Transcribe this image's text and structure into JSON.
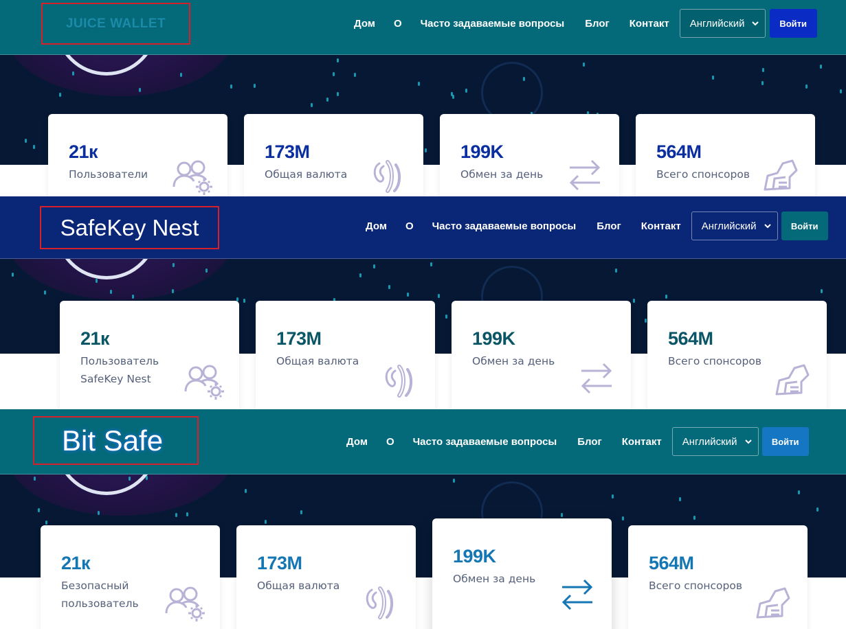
{
  "panels": [
    {
      "logo": "JUICE WALLET",
      "nav": [
        "Дом",
        "О",
        "Часто задаваемые вопросы",
        "Блог",
        "Контакт"
      ],
      "language": "Английский",
      "login": "Войти",
      "stats": [
        {
          "value": "21к",
          "label": "Пользователи",
          "icon": "users-gear-icon"
        },
        {
          "value": "173M",
          "label": "Общая валюта",
          "icon": "currency-icon"
        },
        {
          "value": "199K",
          "label": "Обмен за день",
          "icon": "exchange-arrows-icon"
        },
        {
          "value": "564M",
          "label": "Всего спонсоров",
          "icon": "hand-coin-icon"
        }
      ]
    },
    {
      "logo": "SafeKey Nest",
      "nav": [
        "Дом",
        "О",
        "Часто задаваемые вопросы",
        "Блог",
        "Контакт"
      ],
      "language": "Английский",
      "login": "Войти",
      "stats": [
        {
          "value": "21к",
          "label": "Пользователь SafeKey Nest",
          "icon": "users-gear-icon"
        },
        {
          "value": "173M",
          "label": "Общая валюта",
          "icon": "currency-icon"
        },
        {
          "value": "199K",
          "label": "Обмен за день",
          "icon": "exchange-arrows-icon"
        },
        {
          "value": "564M",
          "label": "Всего спонсоров",
          "icon": "hand-coin-icon"
        }
      ]
    },
    {
      "logo": "Bit Safe",
      "nav": [
        "Дом",
        "О",
        "Часто задаваемые вопросы",
        "Блог",
        "Контакт"
      ],
      "language": "Английский",
      "login": "Войти",
      "stats": [
        {
          "value": "21к",
          "label": "Безопасный пользователь",
          "icon": "users-gear-icon"
        },
        {
          "value": "173M",
          "label": "Общая валюта",
          "icon": "currency-icon"
        },
        {
          "value": "199K",
          "label": "Обмен за день",
          "icon": "exchange-arrows-icon"
        },
        {
          "value": "564M",
          "label": "Всего спонсоров",
          "icon": "hand-coin-icon"
        }
      ]
    }
  ],
  "colors": {
    "teal_nav": "#046a7a",
    "blue_nav": "#0a2677",
    "hero_bg": "#061833",
    "icon_lavender": "#b8b3d6",
    "arrows_active": "#1576b4"
  }
}
